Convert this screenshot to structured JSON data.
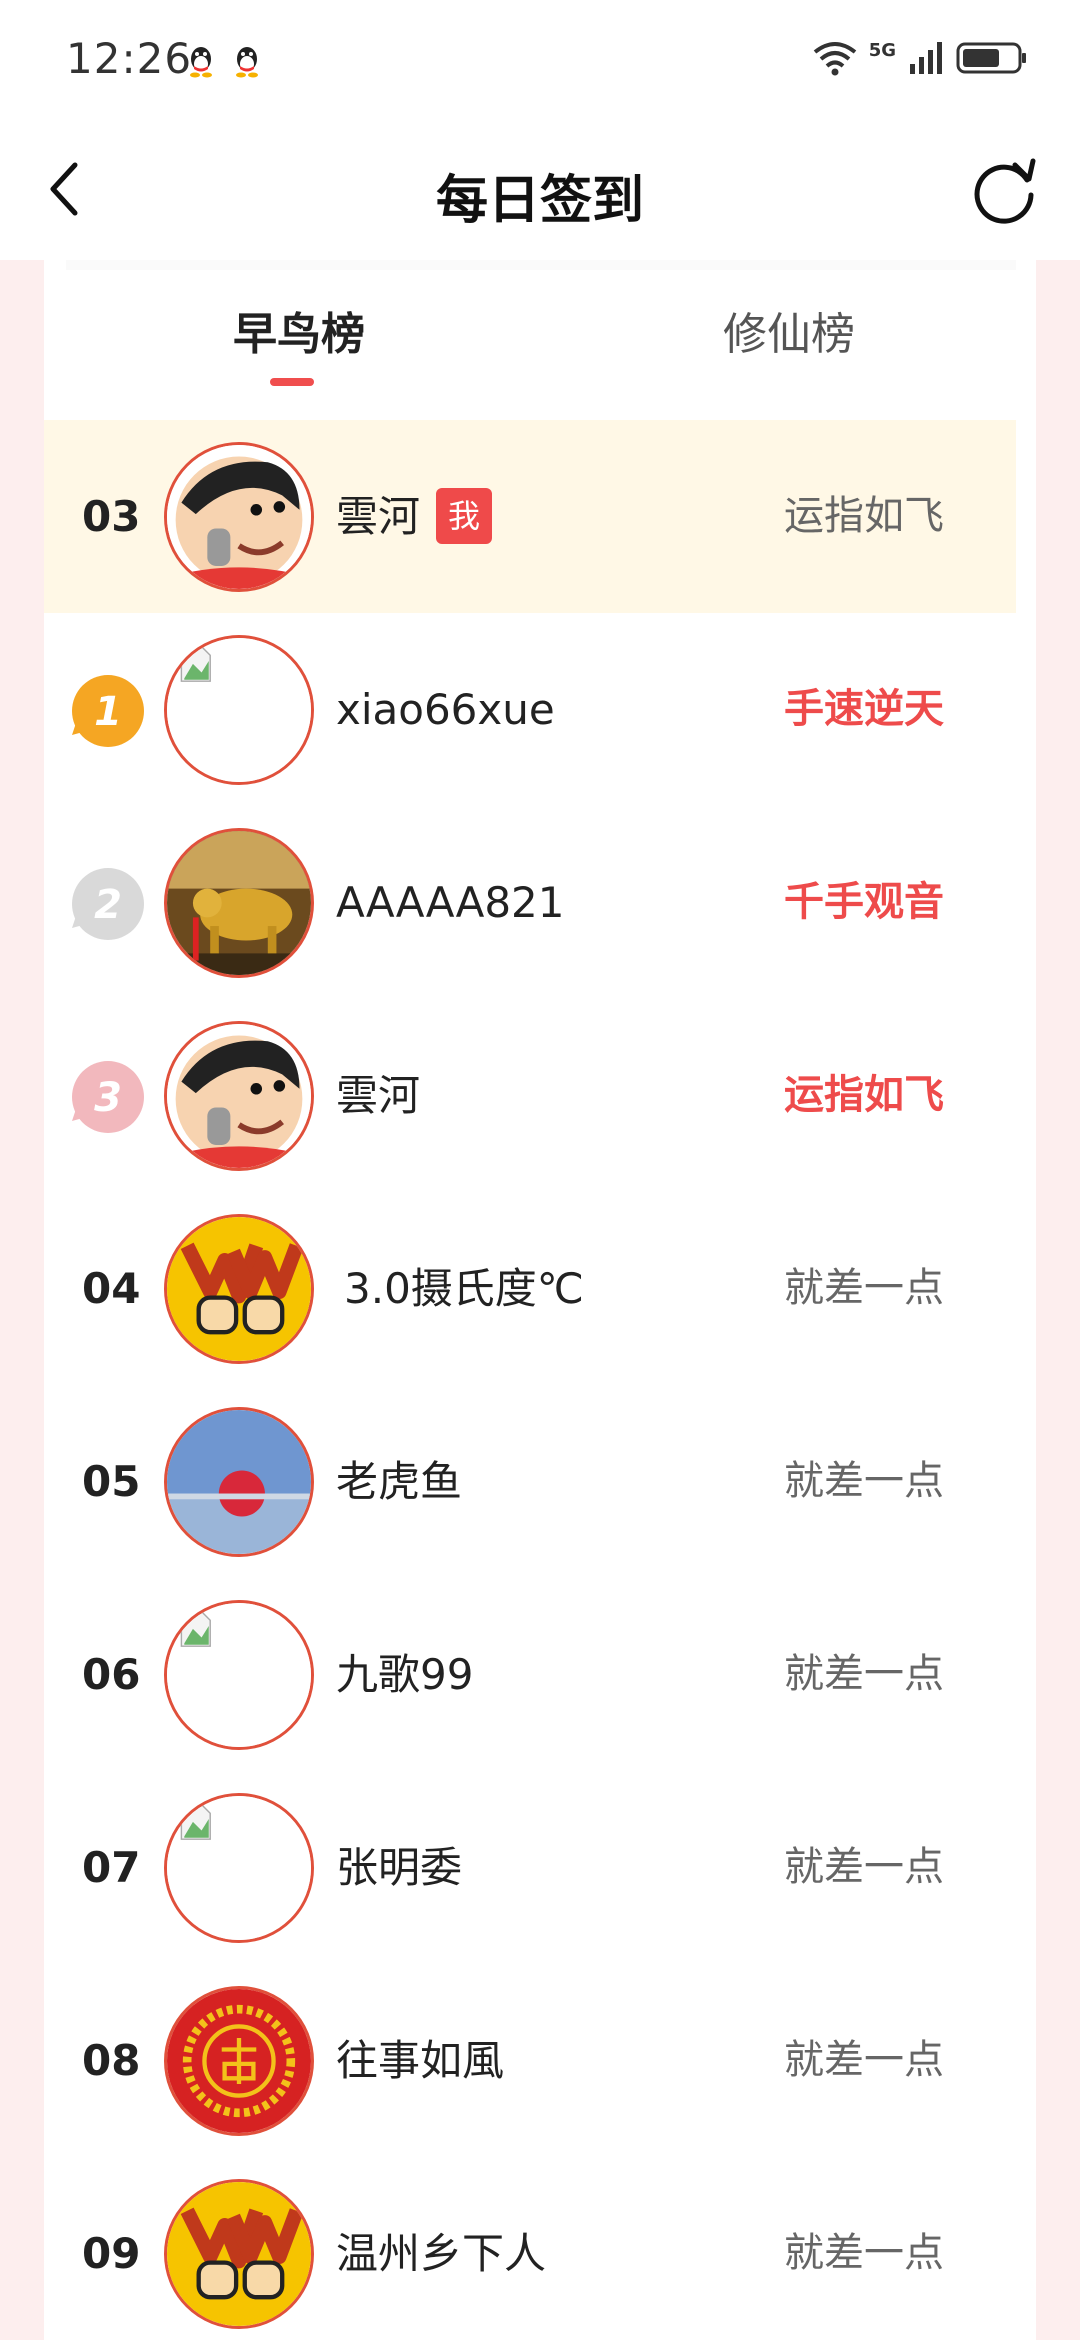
{
  "status_bar": {
    "time": "12:26",
    "network": "5G",
    "icons": [
      "qq-icon",
      "qq-icon",
      "wifi-icon",
      "signal-icon",
      "battery-icon"
    ]
  },
  "header": {
    "title": "每日签到",
    "back_icon": "chevron-left-icon",
    "refresh_icon": "refresh-icon"
  },
  "tabs": [
    {
      "label": "早鸟榜",
      "active": true
    },
    {
      "label": "修仙榜",
      "active": false
    }
  ],
  "colors": {
    "accent": "#ef4a4a",
    "me_row_bg": "#fff8e6",
    "page_bg": "#fdeeee",
    "avatar_border": "#e0503b"
  },
  "rows": [
    {
      "rank": "03",
      "name": "雲河",
      "badge": "我",
      "title": "运指如飞",
      "highlight": false,
      "is_me": true,
      "avatar": "crayon-shin-chan"
    },
    {
      "rank": "1",
      "name": "xiao66xue",
      "badge": "",
      "title": "手速逆天",
      "highlight": true,
      "is_me": false,
      "avatar": "broken-image",
      "medal": "gold"
    },
    {
      "rank": "2",
      "name": "AAAAA821",
      "badge": "",
      "title": "千手观音",
      "highlight": true,
      "is_me": false,
      "avatar": "golden-bull",
      "medal": "silver"
    },
    {
      "rank": "3",
      "name": "雲河",
      "badge": "",
      "title": "运指如飞",
      "highlight": true,
      "is_me": false,
      "avatar": "crayon-shin-chan",
      "medal": "bronze"
    },
    {
      "rank": "04",
      "name": "3.0摄氏度℃",
      "badge": "",
      "title": "就差一点",
      "highlight": false,
      "is_me": false,
      "avatar": "victory-hands"
    },
    {
      "rank": "05",
      "name": "老虎鱼",
      "badge": "",
      "title": "就差一点",
      "highlight": false,
      "is_me": false,
      "avatar": "red-sphere"
    },
    {
      "rank": "06",
      "name": "九歌99",
      "badge": "",
      "title": "就差一点",
      "highlight": false,
      "is_me": false,
      "avatar": "broken-image"
    },
    {
      "rank": "07",
      "name": "张明委",
      "badge": "",
      "title": "就差一点",
      "highlight": false,
      "is_me": false,
      "avatar": "broken-image"
    },
    {
      "rank": "08",
      "name": "往事如風",
      "badge": "",
      "title": "就差一点",
      "highlight": false,
      "is_me": false,
      "avatar": "red-seal"
    },
    {
      "rank": "09",
      "name": "温州乡下人",
      "badge": "",
      "title": "就差一点",
      "highlight": false,
      "is_me": false,
      "avatar": "victory-hands"
    }
  ]
}
